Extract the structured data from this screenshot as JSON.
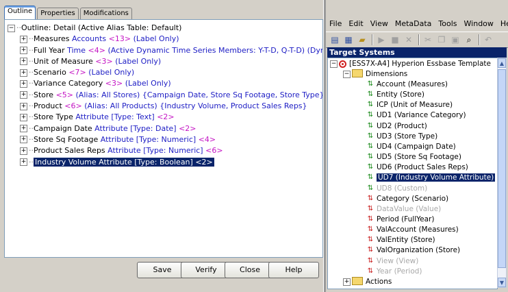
{
  "left_panel": {
    "tabs": [
      {
        "label": "Outline",
        "active": true
      },
      {
        "label": "Properties",
        "active": false
      },
      {
        "label": "Modifications",
        "active": false
      }
    ],
    "root": "Outline: Detail (Active Alias Table: Default)",
    "rows": [
      {
        "name": "Measures",
        "gen": "Accounts",
        "count": "<13>",
        "extra": "(Label Only)"
      },
      {
        "name": "Full Year",
        "gen": "Time",
        "count": "<4>",
        "extra": "(Active Dynamic Time Series Members: Y-T-D, Q-T-D) (Dynamic Calc)"
      },
      {
        "name": "Unit of Measure",
        "gen": "",
        "count": "<3>",
        "extra": "(Label Only)"
      },
      {
        "name": "Scenario",
        "gen": "",
        "count": "<7>",
        "extra": "(Label Only)"
      },
      {
        "name": "Variance Category",
        "gen": "",
        "count": "<3>",
        "extra": "(Label Only)"
      },
      {
        "name": "Store",
        "gen": "",
        "count": "<5>",
        "extra": "(Alias: All Stores) {Campaign Date, Store Sq Footage, Store Type}"
      },
      {
        "name": "Product",
        "gen": "",
        "count": "<6>",
        "extra": "(Alias: All Products) {Industry Volume, Product Sales Reps}"
      },
      {
        "name": "Store Type",
        "gen": "Attribute [Type: Text]",
        "count": "<2>",
        "extra": ""
      },
      {
        "name": "Campaign Date",
        "gen": "Attribute [Type: Date]",
        "count": "<2>",
        "extra": ""
      },
      {
        "name": "Store Sq Footage",
        "gen": "Attribute [Type: Numeric]",
        "count": "<4>",
        "extra": ""
      },
      {
        "name": "Product Sales Reps",
        "gen": "Attribute [Type: Numeric]",
        "count": "<6>",
        "extra": ""
      },
      {
        "name": "Industry Volume",
        "gen": "Attribute [Type: Boolean]",
        "count": "<2>",
        "extra": "",
        "selected": true
      }
    ],
    "buttons": {
      "save": "Save",
      "verify": "Verify",
      "close": "Close",
      "help": "Help"
    }
  },
  "right_panel": {
    "menu": [
      "File",
      "Edit",
      "View",
      "MetaData",
      "Tools",
      "Window",
      "Help"
    ],
    "title": "Target Systems",
    "root": "[ESS7X-A4] Hyperion Essbase Template",
    "dimensions_label": "Dimensions",
    "items": [
      {
        "label": "Account (Measures)",
        "icon": "green-arrow",
        "state": "normal"
      },
      {
        "label": "Entity (Store)",
        "icon": "green-arrow",
        "state": "normal"
      },
      {
        "label": "ICP (Unit of Measure)",
        "icon": "green-arrow",
        "state": "normal"
      },
      {
        "label": "UD1 (Variance Category)",
        "icon": "green-arrow",
        "state": "normal"
      },
      {
        "label": "UD2 (Product)",
        "icon": "green-arrow",
        "state": "normal"
      },
      {
        "label": "UD3 (Store Type)",
        "icon": "green-arrow",
        "state": "normal"
      },
      {
        "label": "UD4 (Campaign Date)",
        "icon": "green-arrow",
        "state": "normal"
      },
      {
        "label": "UD5 (Store Sq Footage)",
        "icon": "green-arrow",
        "state": "normal"
      },
      {
        "label": "UD6 (Product Sales Reps)",
        "icon": "green-arrow",
        "state": "normal"
      },
      {
        "label": "UD7 (Industry Volume Attribute)",
        "icon": "green-arrow",
        "state": "selected"
      },
      {
        "label": "UD8 (Custom)",
        "icon": "green-arrow",
        "state": "gray"
      },
      {
        "label": "Category (Scenario)",
        "icon": "red-arrow",
        "state": "normal"
      },
      {
        "label": "DataValue (Value)",
        "icon": "red-arrow",
        "state": "gray"
      },
      {
        "label": "Period (FullYear)",
        "icon": "red-arrow",
        "state": "normal"
      },
      {
        "label": "ValAccount (Measures)",
        "icon": "red-arrow",
        "state": "normal"
      },
      {
        "label": "ValEntity (Store)",
        "icon": "red-arrow",
        "state": "normal"
      },
      {
        "label": "ValOrganization (Store)",
        "icon": "red-arrow",
        "state": "normal"
      },
      {
        "label": "View (View)",
        "icon": "red-arrow",
        "state": "gray"
      },
      {
        "label": "Year (Period)",
        "icon": "red-arrow",
        "state": "gray"
      }
    ],
    "actions_label": "Actions",
    "colors": {
      "selection": "#0a246a",
      "gen": "#1c1cc4",
      "count": "#c414c4",
      "green": "#1a8a1a",
      "red": "#c81e1e"
    }
  }
}
